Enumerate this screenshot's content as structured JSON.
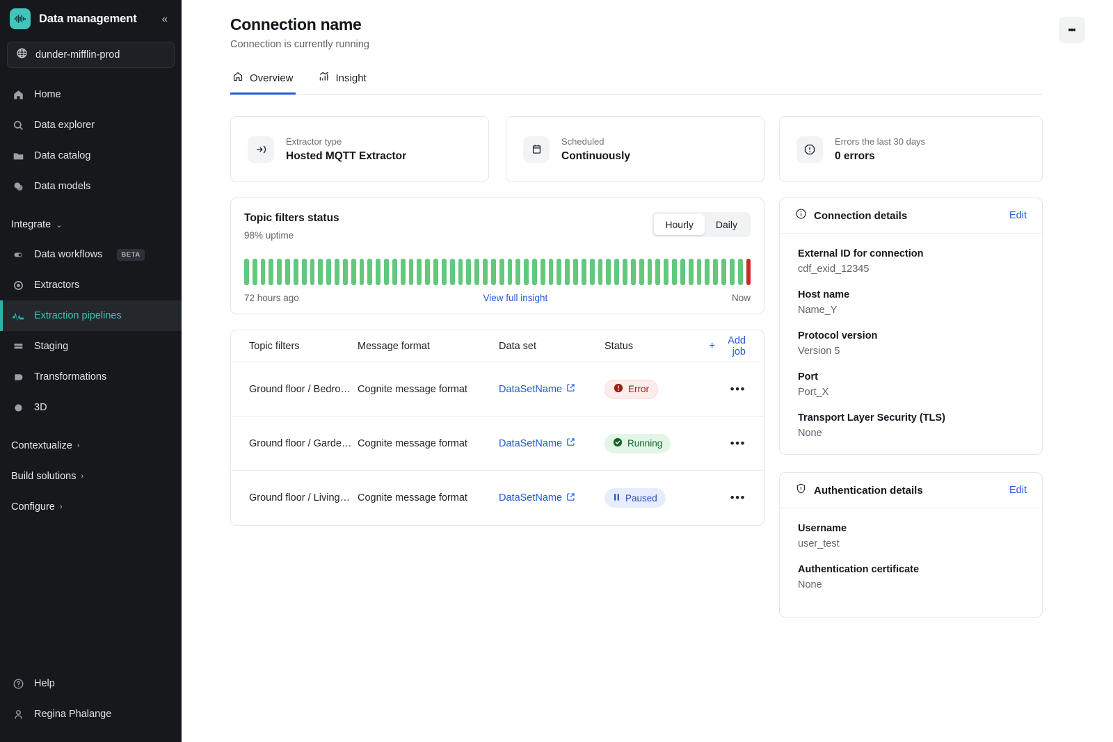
{
  "sidebar": {
    "app_title": "Data management",
    "collapse_label": "«",
    "project": "dunder-mifflin-prod",
    "nav_top": [
      {
        "label": "Home",
        "icon": "home-icon"
      },
      {
        "label": "Data explorer",
        "icon": "search-icon"
      },
      {
        "label": "Data catalog",
        "icon": "folder-icon"
      },
      {
        "label": "Data models",
        "icon": "models-icon"
      }
    ],
    "group_integrate": "Integrate",
    "nav_integrate": [
      {
        "label": "Data workflows",
        "icon": "workflow-icon",
        "badge": "BETA",
        "active": false
      },
      {
        "label": "Extractors",
        "icon": "extractors-icon",
        "badge": "",
        "active": false
      },
      {
        "label": "Extraction pipelines",
        "icon": "pipelines-icon",
        "badge": "",
        "active": true
      },
      {
        "label": "Staging",
        "icon": "staging-icon",
        "badge": "",
        "active": false
      },
      {
        "label": "Transformations",
        "icon": "transformations-icon",
        "badge": "",
        "active": false
      },
      {
        "label": "3D",
        "icon": "cube-icon",
        "badge": "",
        "active": false
      }
    ],
    "groups_bottom": [
      "Contextualize",
      "Build solutions",
      "Configure"
    ],
    "help": "Help",
    "user": "Regina Phalange",
    "accent_color": "#2bb3a8",
    "logo_color": "#45c4bc"
  },
  "header": {
    "title": "Connection name",
    "subtitle": "Connection is currently running",
    "menu_icon": "kebab-menu-icon"
  },
  "tabs": [
    {
      "label": "Overview",
      "icon": "home-icon",
      "active": true
    },
    {
      "label": "Insight",
      "icon": "chart-icon",
      "active": false
    }
  ],
  "kpis": [
    {
      "label": "Extractor type",
      "value": "Hosted MQTT Extractor",
      "icon": "login-arrow-icon"
    },
    {
      "label": "Scheduled",
      "value": "Continuously",
      "icon": "calendar-icon"
    },
    {
      "label": "Errors the last 30 days",
      "value": "0 errors",
      "icon": "alert-octagon-icon"
    }
  ],
  "status": {
    "title": "Topic filters status",
    "uptime": "98% uptime",
    "segments": [
      {
        "label": "Hourly",
        "active": true
      },
      {
        "label": "Daily",
        "active": false
      }
    ],
    "left_label": "72 hours ago",
    "link_label": "View full insight",
    "right_label": "Now",
    "ok_color": "#61c87c",
    "error_color": "#c72b23"
  },
  "chart_data": {
    "type": "bar",
    "title": "Topic filters status",
    "xlabel": "",
    "ylabel": "",
    "categories": [
      "72 hours ago",
      "Now"
    ],
    "bar_count": 62,
    "ok_count": 61,
    "error_count": 1,
    "error_indices": [
      61
    ],
    "uptime_percent": 98,
    "granularity": "Hourly",
    "grid": false,
    "legend": "none"
  },
  "table": {
    "columns": [
      "Topic filters",
      "Message format",
      "Data set",
      "Status"
    ],
    "add_job_label": "Add job",
    "rows": [
      {
        "topic": "Ground floor / Bedro…",
        "format": "Cognite message format",
        "dataset": "DataSetName",
        "status": "Error",
        "status_kind": "error"
      },
      {
        "topic": "Ground floor / Garde…",
        "format": "Cognite message format",
        "dataset": "DataSetName",
        "status": "Running",
        "status_kind": "running"
      },
      {
        "topic": "Ground floor / Living…",
        "format": "Cognite message format",
        "dataset": "DataSetName",
        "status": "Paused",
        "status_kind": "paused"
      }
    ]
  },
  "connection_details": {
    "title": "Connection details",
    "edit": "Edit",
    "fields": [
      {
        "label": "External ID for connection",
        "value": "cdf_exid_12345"
      },
      {
        "label": "Host name",
        "value": "Name_Y"
      },
      {
        "label": "Protocol version",
        "value": "Version 5"
      },
      {
        "label": "Port",
        "value": "Port_X"
      },
      {
        "label": "Transport Layer Security (TLS)",
        "value": "None"
      }
    ]
  },
  "auth_details": {
    "title": "Authentication details",
    "edit": "Edit",
    "fields": [
      {
        "label": "Username",
        "value": "user_test"
      },
      {
        "label": "Authentication certificate",
        "value": "None"
      }
    ]
  }
}
